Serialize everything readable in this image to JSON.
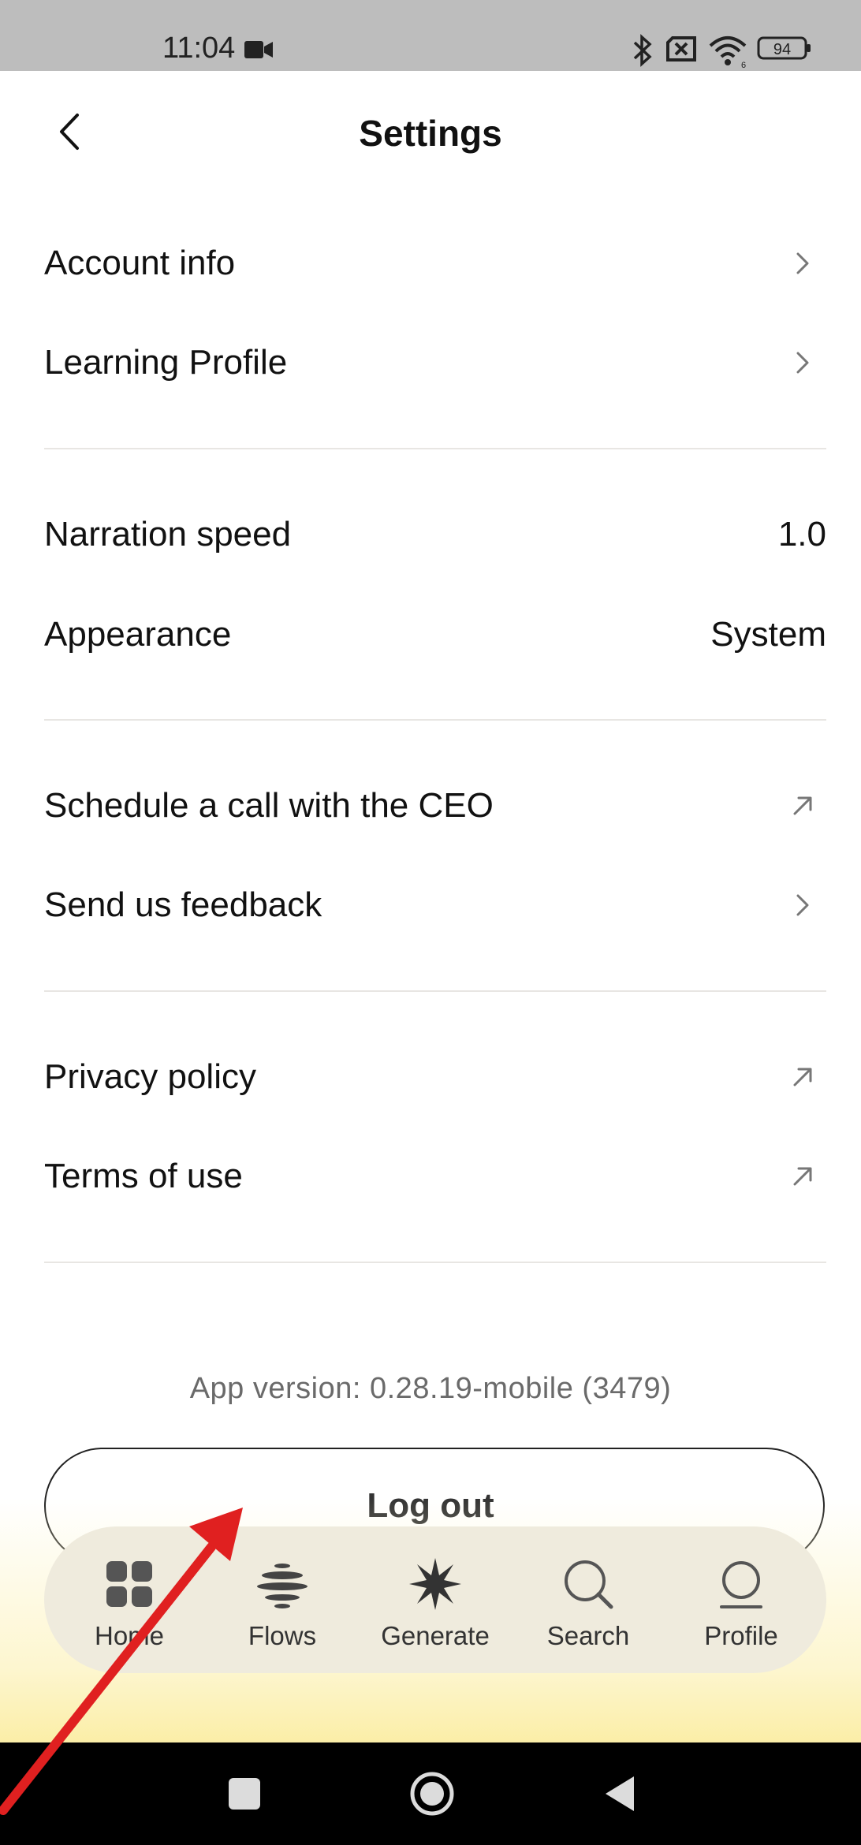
{
  "status_bar": {
    "time": "11:04",
    "battery": "94",
    "icons": [
      "camera-icon",
      "bluetooth-icon",
      "sim-off-icon",
      "wifi-icon",
      "battery-icon"
    ]
  },
  "header": {
    "title": "Settings",
    "back_icon": "chevron-left-icon"
  },
  "groups": [
    {
      "rows": [
        {
          "label": "Account info",
          "value": "",
          "icon": "chevron-right-icon"
        },
        {
          "label": "Learning Profile",
          "value": "",
          "icon": "chevron-right-icon"
        }
      ]
    },
    {
      "rows": [
        {
          "label": "Narration speed",
          "value": "1.0",
          "icon": ""
        },
        {
          "label": "Appearance",
          "value": "System",
          "icon": ""
        }
      ]
    },
    {
      "rows": [
        {
          "label": "Schedule a call with the CEO",
          "value": "",
          "icon": "external-link-icon"
        },
        {
          "label": "Send us feedback",
          "value": "",
          "icon": "chevron-right-icon"
        }
      ]
    },
    {
      "rows": [
        {
          "label": "Privacy policy",
          "value": "",
          "icon": "external-link-icon"
        },
        {
          "label": "Terms of use",
          "value": "",
          "icon": "external-link-icon"
        }
      ]
    }
  ],
  "app_version": "App version: 0.28.19-mobile (3479)",
  "logout_label": "Log out",
  "tabs": [
    {
      "label": "Home",
      "icon": "grid-icon"
    },
    {
      "label": "Flows",
      "icon": "flows-icon"
    },
    {
      "label": "Generate",
      "icon": "sparkle-icon"
    },
    {
      "label": "Search",
      "icon": "search-icon"
    },
    {
      "label": "Profile",
      "icon": "profile-icon"
    }
  ],
  "colors": {
    "tabbar_bg": "#efebdd",
    "annotation_arrow": "#e02020"
  }
}
